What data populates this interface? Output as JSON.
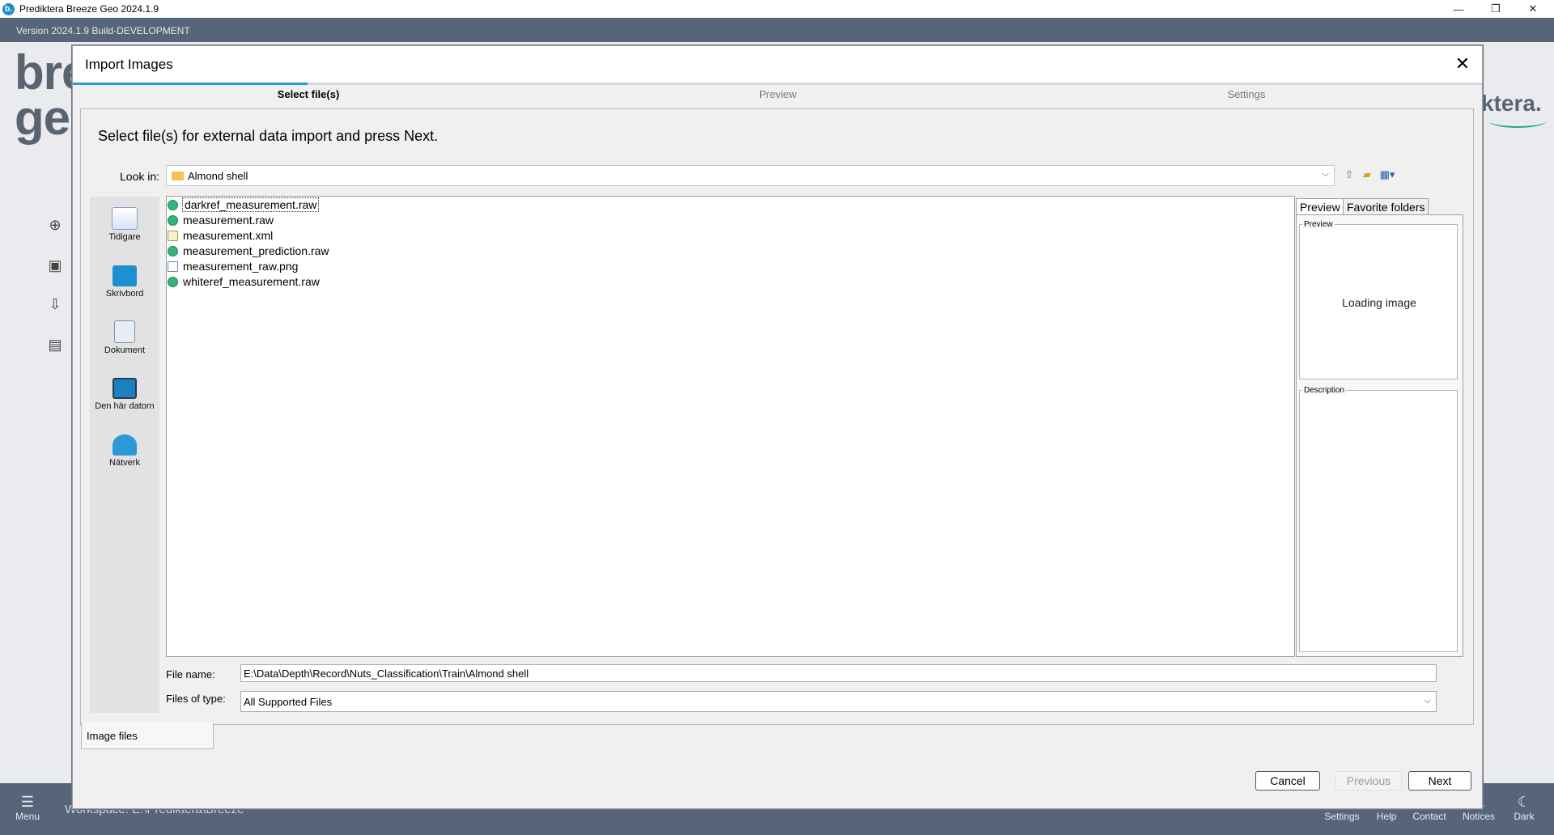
{
  "window": {
    "title": "Prediktera Breeze Geo 2024.1.9",
    "logo_letter": "b.",
    "minimize": "—",
    "maximize": "❐",
    "close": "✕"
  },
  "app": {
    "version": "Version 2024.1.9 Build-DEVELOPMENT",
    "brand_left": "bre\nge",
    "brand_right": "ktera.",
    "workspace": "Workspace:  E:\\Prediktera\\Breeze",
    "bottom_nav": [
      {
        "label": "Menu",
        "icon": "☰"
      },
      {
        "label": "Settings",
        "icon": "⚙"
      },
      {
        "label": "Help",
        "icon": "?"
      },
      {
        "label": "Contact",
        "icon": "✉"
      },
      {
        "label": "Notices",
        "icon": "⚠"
      },
      {
        "label": "Dark",
        "icon": "☾"
      }
    ]
  },
  "dialog": {
    "title": "Import Images",
    "close": "✕",
    "steps": [
      "Select file(s)",
      "Preview",
      "Settings"
    ],
    "active_step": 0,
    "instruction": "Select file(s) for external data import and press Next.",
    "look_in_label": "Look in:",
    "look_in_value": "Almond shell",
    "places": [
      "Tidigare",
      "Skrivbord",
      "Dokument",
      "Den här datorn",
      "Nätverk"
    ],
    "files": [
      {
        "name": "darkref_measurement.raw",
        "type": "raw"
      },
      {
        "name": "measurement.raw",
        "type": "raw"
      },
      {
        "name": "measurement.xml",
        "type": "xml"
      },
      {
        "name": "measurement_prediction.raw",
        "type": "raw"
      },
      {
        "name": "measurement_raw.png",
        "type": "png"
      },
      {
        "name": "whiteref_measurement.raw",
        "type": "raw"
      }
    ],
    "preview_tabs": [
      "Preview",
      "Favorite folders"
    ],
    "preview_group": "Preview",
    "preview_status": "Loading image",
    "description_group": "Description",
    "file_name_label": "File name:",
    "file_name_value": "E:\\Data\\Depth\\Record\\Nuts_Classification\\Train\\Almond shell",
    "file_type_label": "Files of type:",
    "file_type_value": "All Supported Files",
    "sub_tab": "Image files",
    "buttons": {
      "cancel": "Cancel",
      "previous": "Previous",
      "next": "Next"
    }
  }
}
